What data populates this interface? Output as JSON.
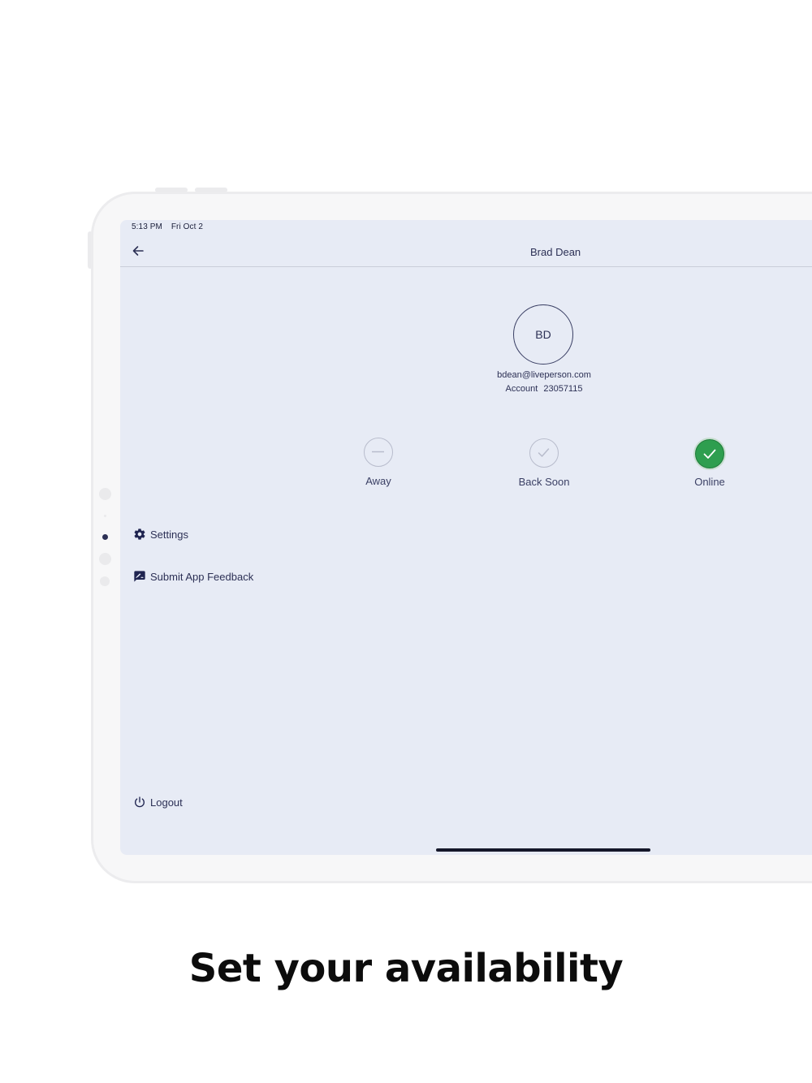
{
  "status_bar": {
    "time": "5:13 PM",
    "date": "Fri Oct 2"
  },
  "header": {
    "back_icon": "arrow-left-icon",
    "title": "Brad Dean"
  },
  "profile": {
    "initials": "BD",
    "email": "bdean@liveperson.com",
    "account_label": "Account",
    "account_number": "23057115"
  },
  "availability": {
    "selected": "Online",
    "options": [
      {
        "label": "Away",
        "icon": "minus-circle-icon"
      },
      {
        "label": "Back Soon",
        "icon": "check-circle-outline-icon"
      },
      {
        "label": "Online",
        "icon": "check-circle-filled-icon",
        "color": "#2e9e4f"
      }
    ]
  },
  "menu": {
    "settings": {
      "label": "Settings",
      "icon": "gear-icon"
    },
    "feedback": {
      "label": "Submit App Feedback",
      "icon": "feedback-icon"
    },
    "logout": {
      "label": "Logout",
      "icon": "power-icon"
    }
  },
  "caption": "Set your availability",
  "colors": {
    "screen_bg": "#e7ebf5",
    "text": "#2c3055",
    "online_green": "#2e9e4f"
  }
}
